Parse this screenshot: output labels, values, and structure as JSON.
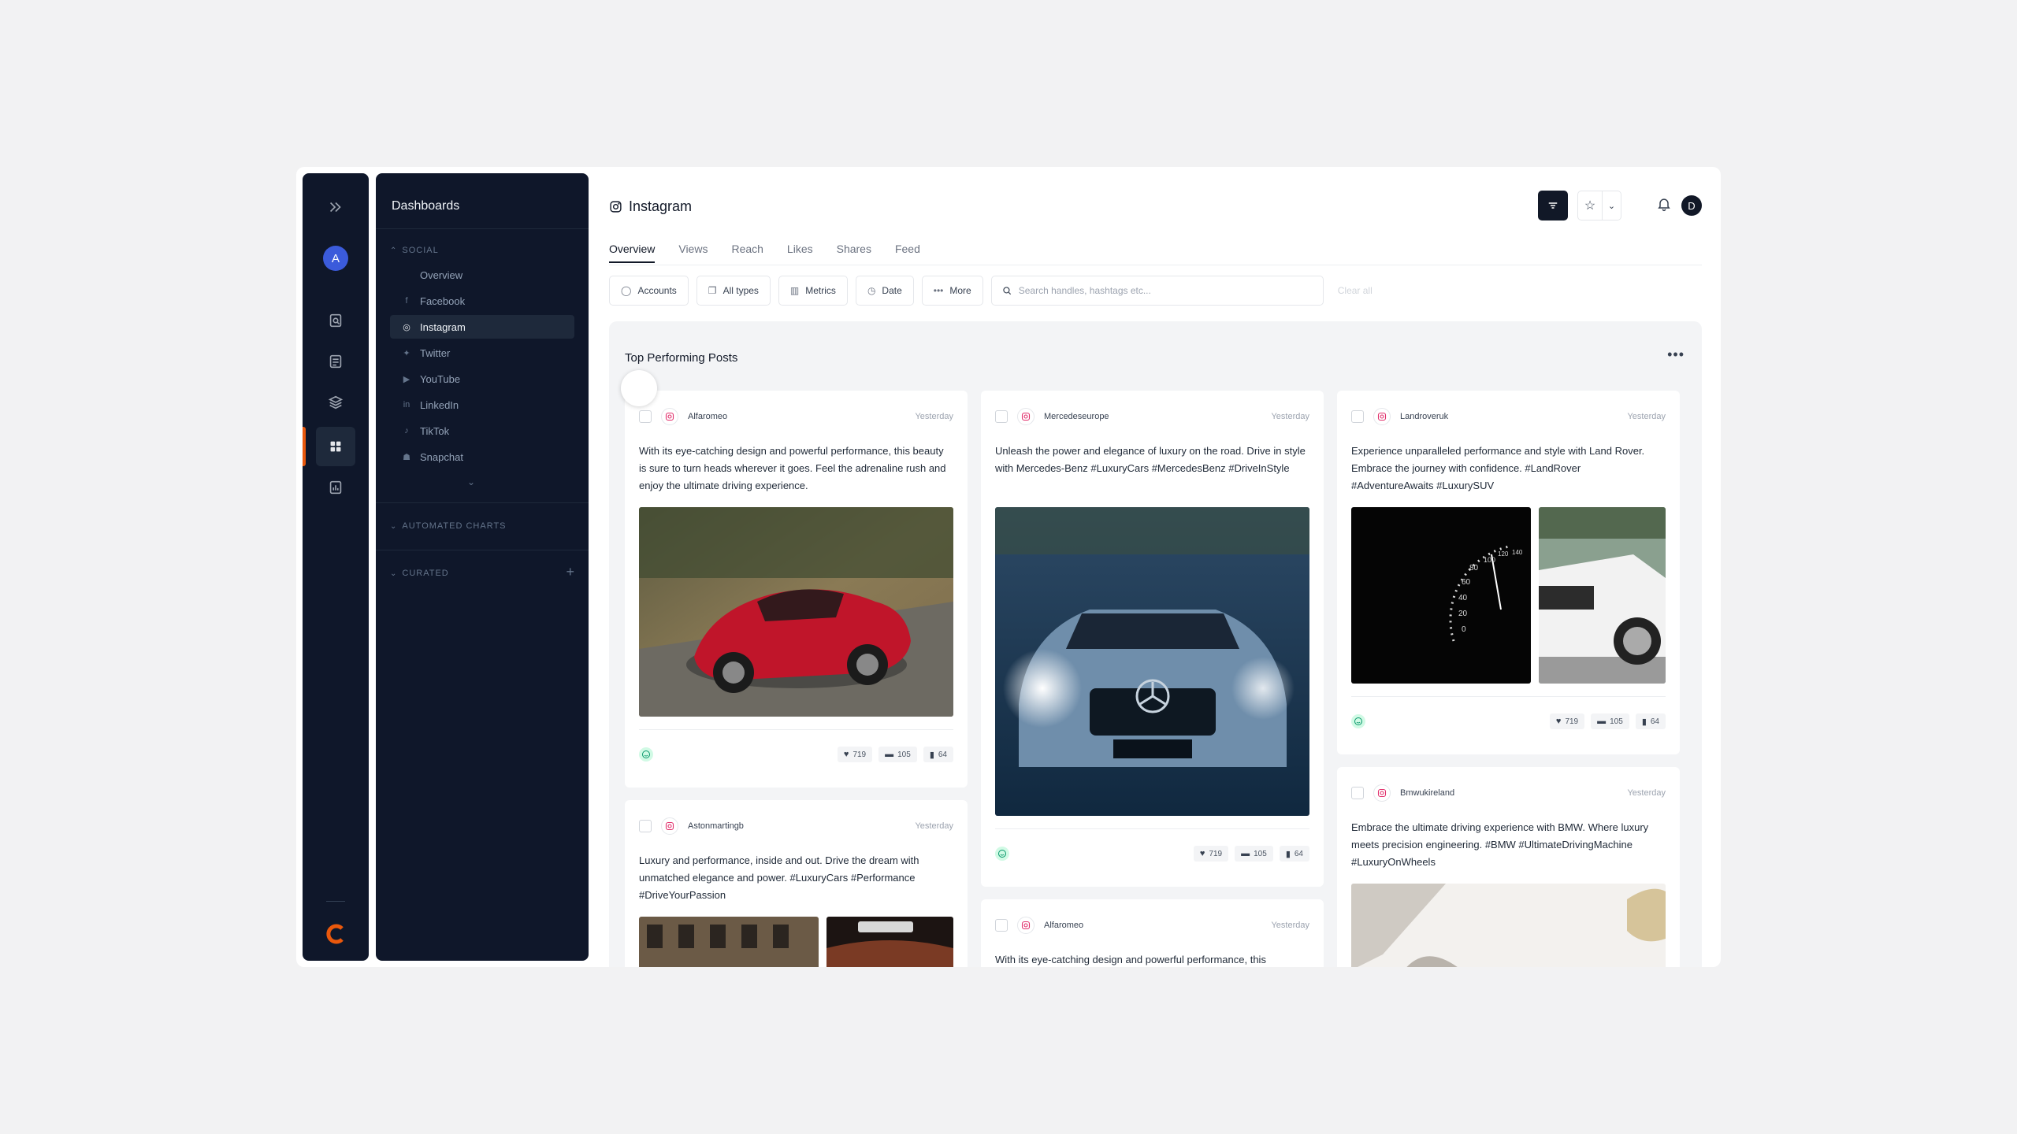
{
  "rail": {
    "avatar_initial": "A",
    "icons": [
      "expand-icon",
      "social-listening-icon",
      "reports-icon",
      "layers-icon",
      "dashboard-icon",
      "analytics-icon"
    ],
    "accent_color": "#ea580c"
  },
  "sidebar": {
    "title": "Dashboards",
    "sections": {
      "social": "SOCIAL",
      "automated": "AUTOMATED CHARTS",
      "curated": "CURATED"
    },
    "items": [
      {
        "label": "Overview",
        "icon": ""
      },
      {
        "label": "Facebook",
        "icon": "facebook-icon"
      },
      {
        "label": "Instagram",
        "icon": "instagram-icon"
      },
      {
        "label": "Twitter",
        "icon": "twitter-icon"
      },
      {
        "label": "YouTube",
        "icon": "youtube-icon"
      },
      {
        "label": "LinkedIn",
        "icon": "linkedin-icon"
      },
      {
        "label": "TikTok",
        "icon": "tiktok-icon"
      },
      {
        "label": "Snapchat",
        "icon": "snapchat-icon"
      }
    ],
    "active_item": "Instagram"
  },
  "header": {
    "title": "Instagram",
    "user_initial": "D"
  },
  "tabs": [
    "Overview",
    "Views",
    "Reach",
    "Likes",
    "Shares",
    "Feed"
  ],
  "active_tab": "Overview",
  "filters": {
    "accounts": "Accounts",
    "types": "All types",
    "metrics": "Metrics",
    "date": "Date",
    "more": "More",
    "search_placeholder": "Search handles, hashtags etc...",
    "clear": "Clear all"
  },
  "board": {
    "title": "Top Performing Posts",
    "posts": [
      {
        "account": "Alfaromeo",
        "time": "Yesterday",
        "text": "With its eye-catching design and powerful performance, this beauty is sure to turn heads wherever it goes. Feel the adrenaline rush and enjoy the ultimate driving experience.",
        "likes": "719",
        "comments": "105",
        "saves": "64"
      },
      {
        "account": "Mercedeseurope",
        "time": "Yesterday",
        "text": "Unleash the power and elegance of luxury on the road. Drive in style with Mercedes-Benz #LuxuryCars #MercedesBenz #DriveInStyle",
        "likes": "719",
        "comments": "105",
        "saves": "64"
      },
      {
        "account": "Landroveruk",
        "time": "Yesterday",
        "text": "Experience unparalleled performance and style with Land Rover. Embrace the journey with confidence. #LandRover #AdventureAwaits #LuxurySUV",
        "likes": "719",
        "comments": "105",
        "saves": "64"
      },
      {
        "account": "Astonmartingb",
        "time": "Yesterday",
        "text": "Luxury and performance, inside and out. Drive the dream with unmatched elegance and power. #LuxuryCars #Performance #DriveYourPassion"
      },
      {
        "account": "Alfaromeo",
        "time": "Yesterday",
        "text": "With its eye-catching design and powerful performance, this"
      },
      {
        "account": "Bmwukireland",
        "time": "Yesterday",
        "text": "Embrace the ultimate driving experience with BMW. Where luxury meets precision engineering. #BMW #UltimateDrivingMachine #LuxuryOnWheels"
      }
    ],
    "speedometer_ticks": [
      "0",
      "20",
      "40",
      "60",
      "80",
      "100",
      "120",
      "140"
    ]
  }
}
